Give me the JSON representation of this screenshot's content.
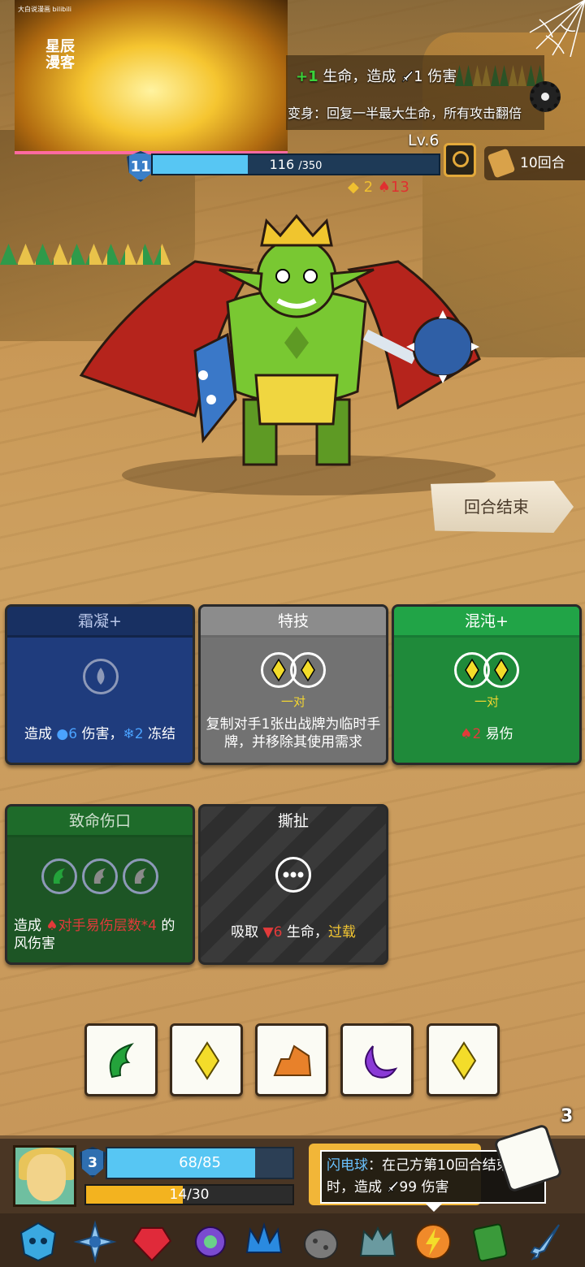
{
  "video_overlay": {
    "tiny_caption": "大白说漫画 bilibili",
    "brand": "星辰漫客"
  },
  "enemy": {
    "intent_line1": {
      "plus": "+1",
      "text": " 生命，造成 ",
      "value": "1",
      "suffix": " 伤害"
    },
    "intent_line2": "变身：回复一半最大生命，所有攻击翻倍",
    "level": "Lv.6",
    "shield": "11",
    "hp_current": "116",
    "hp_max": "/350",
    "hp_fraction": 0.331,
    "rounds": "10回合",
    "status": {
      "agility": "2",
      "vulnerable": "13"
    }
  },
  "end_turn_label": "回合结束",
  "cards": {
    "frost": {
      "title": "霜凝+",
      "desc_pre": "造成 ",
      "dmg": "6",
      "desc_mid": " 伤害，",
      "freeze": "2",
      "desc_post": " 冻结"
    },
    "skill": {
      "title": "特技",
      "slot_label": "一对",
      "desc": "复制对手1张出战牌为临时手牌，并移除其使用需求"
    },
    "chaos": {
      "title": "混沌+",
      "slot_label": "一对",
      "vuln": "2",
      "desc_post": " 易伤"
    },
    "wound": {
      "title": "致命伤口",
      "desc_pre": "造成 ",
      "formula": "对手易伤层数*4",
      "desc_post": " 的风伤害"
    },
    "tear": {
      "title": "撕扯",
      "desc_pre": "吸取 ",
      "drain": "6",
      "desc_mid": " 生命，",
      "overload": "过载"
    }
  },
  "dice": [
    {
      "name": "leaf-die-icon",
      "color": "#24a33b"
    },
    {
      "name": "diamond-die-icon",
      "color": "#f3dc2a"
    },
    {
      "name": "mountain-die-icon",
      "color": "#e8812a"
    },
    {
      "name": "moon-die-icon",
      "color": "#8a3ad6"
    },
    {
      "name": "diamond-die-icon",
      "color": "#f3dc2a"
    }
  ],
  "player": {
    "shield": "3",
    "hp": "68/85",
    "hp_fraction": 0.8,
    "energy": "14/30",
    "energy_fraction": 0.467
  },
  "tooltip": {
    "name": "闪电球",
    "text1": "：在己方第10回合结束",
    "text2": "时，造成 ",
    "value": "99",
    "text3": " 伤害"
  },
  "dice_count": "3",
  "relics": [
    "blue-skull-relic-icon",
    "snowflake-relic-icon",
    "ruby-relic-icon",
    "purple-charm-relic-icon",
    "ice-crown-relic-icon",
    "stone-egg-relic-icon",
    "gargoyle-relic-icon",
    "lightning-orb-relic-icon",
    "moss-book-relic-icon",
    "ice-dagger-relic-icon"
  ],
  "colors": {
    "accent_gold": "#f2c531",
    "hp_blue": "#57c6f3",
    "danger_red": "#e03030"
  }
}
